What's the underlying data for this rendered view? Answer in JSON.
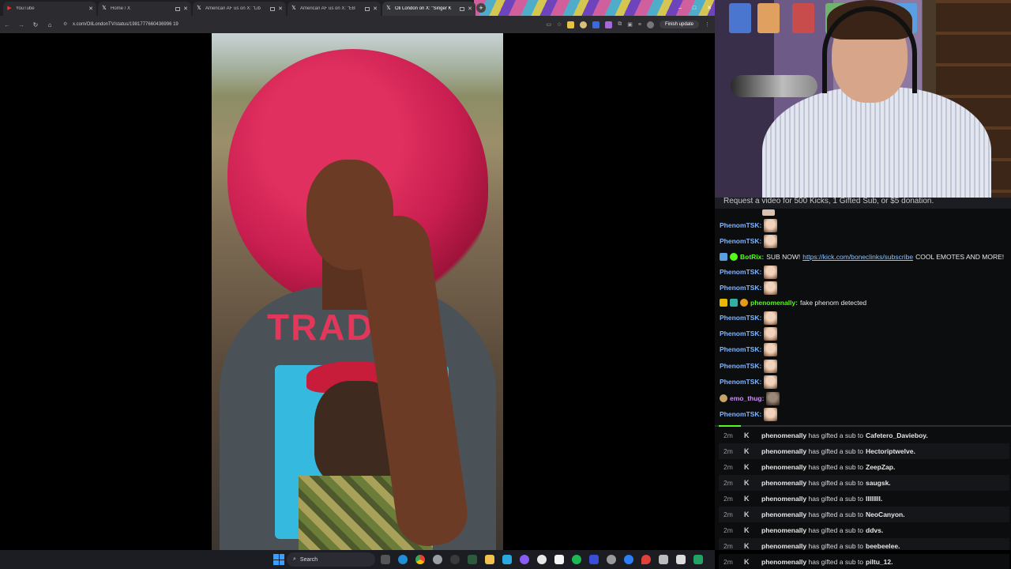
{
  "browser": {
    "tabs": [
      {
        "title": "YouTube",
        "favicon": "youtube-icon",
        "active": false
      },
      {
        "title": "Home / X",
        "favicon": "x-icon",
        "active": false
      },
      {
        "title": "American AF us on X: \"Lib",
        "favicon": "x-icon",
        "active": false
      },
      {
        "title": "American AF us on X: \"EB",
        "favicon": "x-icon",
        "active": false
      },
      {
        "title": "Oli London on X: \"Singer K",
        "favicon": "x-icon",
        "active": true
      }
    ],
    "url": "x.com/OliLondonTV/status/1981777660436996 19",
    "finish_update_label": "Finish update",
    "window_controls": {
      "minimize": "–",
      "maximize": "□",
      "close": "✕"
    }
  },
  "video": {
    "shirt_print": "TRADR"
  },
  "chat": {
    "pinned": "Request a video for 500 Kicks, 1 Gifted Sub, or $5 donation.",
    "messages": [
      {
        "user": "PhenomTSK:",
        "text": "",
        "user_color": "#7fb6ff",
        "emote": true
      },
      {
        "user": "PhenomTSK:",
        "text": "",
        "user_color": "#7fb6ff",
        "emote": true
      },
      {
        "user": "BotRix:",
        "text": "SUB NOW!",
        "link": "https://kick.com/boneclinks/subscribe",
        "suffix": "COOL EMOTES AND MORE!",
        "user_color": "#53fc18",
        "emote": false
      },
      {
        "user": "PhenomTSK:",
        "text": "",
        "user_color": "#7fb6ff",
        "emote": true
      },
      {
        "user": "PhenomTSK:",
        "text": "",
        "user_color": "#7fb6ff",
        "emote": true
      },
      {
        "user": "phenomenally:",
        "text": "fake phenom detected",
        "user_color": "#53fc18",
        "emote": false
      },
      {
        "user": "PhenomTSK:",
        "text": "",
        "user_color": "#7fb6ff",
        "emote": true
      },
      {
        "user": "PhenomTSK:",
        "text": "",
        "user_color": "#7fb6ff",
        "emote": true
      },
      {
        "user": "PhenomTSK:",
        "text": "",
        "user_color": "#7fb6ff",
        "emote": true
      },
      {
        "user": "PhenomTSK:",
        "text": "",
        "user_color": "#7fb6ff",
        "emote": true
      },
      {
        "user": "PhenomTSK:",
        "text": "",
        "user_color": "#7fb6ff",
        "emote": true
      },
      {
        "user": "emo_thug:",
        "text": "",
        "user_color": "#d18bff",
        "emote": true
      },
      {
        "user": "PhenomTSK:",
        "text": "",
        "user_color": "#7fb6ff",
        "emote": true
      }
    ],
    "gift_events": [
      {
        "time": "2m",
        "gifter": "phenomenally",
        "phrase": "has gifted a sub to",
        "recipient": "Cafetero_Davieboy."
      },
      {
        "time": "2m",
        "gifter": "phenomenally",
        "phrase": "has gifted a sub to",
        "recipient": "Hectoriptwelve."
      },
      {
        "time": "2m",
        "gifter": "phenomenally",
        "phrase": "has gifted a sub to",
        "recipient": "ZeepZap."
      },
      {
        "time": "2m",
        "gifter": "phenomenally",
        "phrase": "has gifted a sub to",
        "recipient": "saugsk."
      },
      {
        "time": "2m",
        "gifter": "phenomenally",
        "phrase": "has gifted a sub to",
        "recipient": "IIIIIIII."
      },
      {
        "time": "2m",
        "gifter": "phenomenally",
        "phrase": "has gifted a sub to",
        "recipient": "NeoCanyon."
      },
      {
        "time": "2m",
        "gifter": "phenomenally",
        "phrase": "has gifted a sub to",
        "recipient": "ddvs."
      },
      {
        "time": "2m",
        "gifter": "phenomenally",
        "phrase": "has gifted a sub to",
        "recipient": "beebeelee."
      },
      {
        "time": "2m",
        "gifter": "phenomenally",
        "phrase": "has gifted a sub to",
        "recipient": "piltu_12."
      }
    ],
    "kick_glyph": "K"
  },
  "taskbar": {
    "search_label": "Search",
    "pinned_apps": [
      "file-explorer-icon",
      "edge-icon",
      "chrome-icon",
      "chrome-alt-icon",
      "obs-icon",
      "terminal-icon",
      "folder-icon",
      "paint-icon",
      "settings-icon",
      "notion-icon",
      "spotify-icon",
      "vscode-icon",
      "browser-icon",
      "pin-icon",
      "snip-icon",
      "mail-icon",
      "excel-icon",
      "app-icon"
    ]
  },
  "colors": {
    "kick_green": "#53fc18",
    "link": "#8cc4ff"
  }
}
